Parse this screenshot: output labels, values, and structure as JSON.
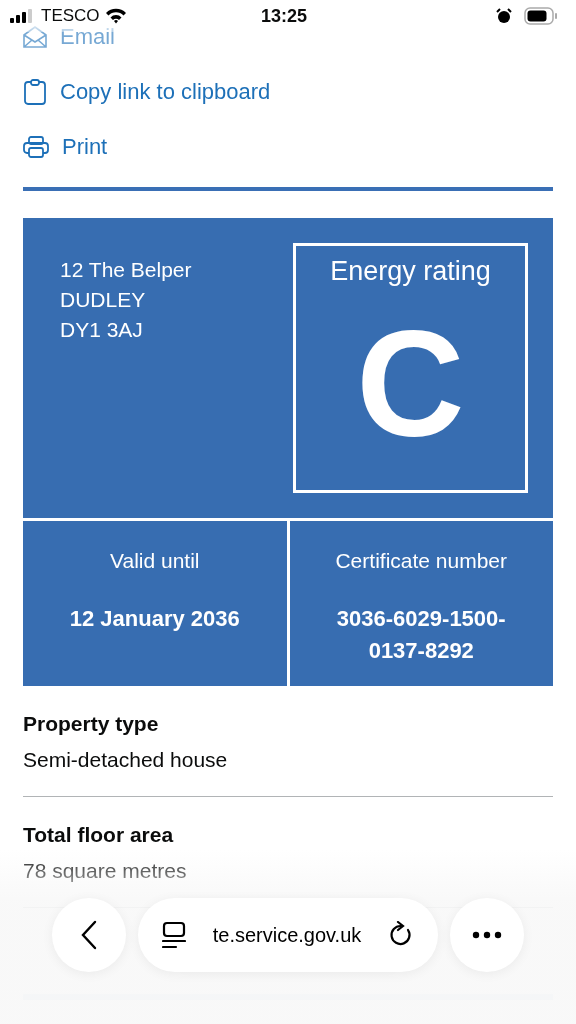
{
  "status_bar": {
    "carrier": "TESCO",
    "time": "13:25"
  },
  "share_links": [
    {
      "label": "Email",
      "kind": "email"
    },
    {
      "label": "Copy link to clipboard",
      "kind": "copy"
    },
    {
      "label": "Print",
      "kind": "print"
    }
  ],
  "certificate": {
    "address": [
      "12 The Belper",
      "DUDLEY",
      "DY1 3AJ"
    ],
    "rating_label": "Energy rating",
    "rating": "C",
    "valid_label": "Valid until",
    "valid_until": "12 January 2036",
    "number_label": "Certificate number",
    "number": "3036-6029-1500-0137-8292"
  },
  "summary": [
    {
      "term": "Property type",
      "value": "Semi-detached house"
    },
    {
      "term": "Total floor area",
      "value": "78 square metres"
    }
  ],
  "browser_bar": {
    "url": "te.service.gov.uk"
  }
}
